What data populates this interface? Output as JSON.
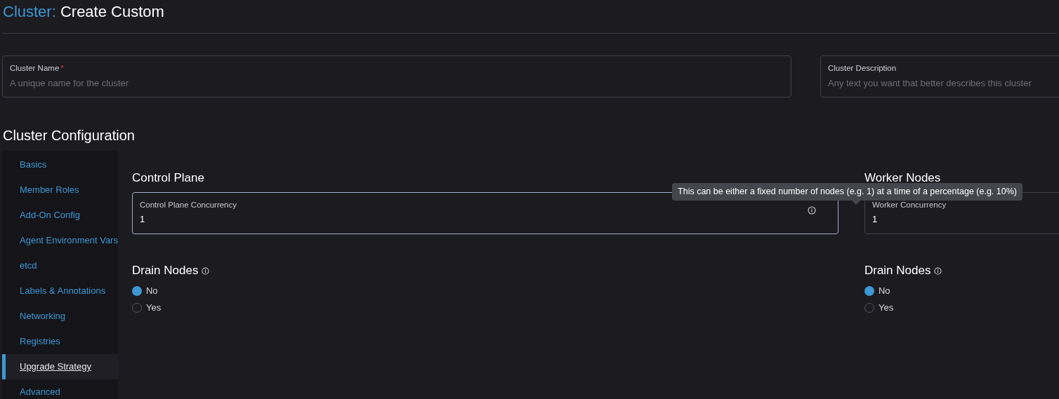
{
  "title": {
    "prefix": "Cluster:",
    "text": "Create Custom"
  },
  "fields": [
    {
      "label": "Cluster Name",
      "required_mark": "*",
      "placeholder": "A unique name for the cluster"
    },
    {
      "label": "Cluster Description",
      "placeholder": "Any text you want that better describes this cluster"
    }
  ],
  "section_title": "Cluster Configuration",
  "sidebar": {
    "items": [
      {
        "label": "Basics",
        "selected": false
      },
      {
        "label": "Member Roles",
        "selected": false
      },
      {
        "label": "Add-On Config",
        "selected": false
      },
      {
        "label": "Agent Environment Vars",
        "selected": false
      },
      {
        "label": "etcd",
        "selected": false
      },
      {
        "label": "Labels & Annotations",
        "selected": false
      },
      {
        "label": "Networking",
        "selected": false
      },
      {
        "label": "Registries",
        "selected": false
      },
      {
        "label": "Upgrade Strategy",
        "selected": true
      },
      {
        "label": "Advanced",
        "selected": false
      }
    ]
  },
  "columns": [
    {
      "heading": "Control Plane",
      "field": {
        "label": "Control Plane Concurrency",
        "value": "1",
        "info": true,
        "focused": true
      },
      "drain": {
        "heading": "Drain Nodes",
        "options": [
          {
            "label": "No",
            "selected": true
          },
          {
            "label": "Yes",
            "selected": false
          }
        ]
      }
    },
    {
      "heading": "Worker Nodes",
      "field": {
        "label": "Worker Concurrency",
        "value": "1",
        "info": false,
        "focused": false
      },
      "drain": {
        "heading": "Drain Nodes",
        "options": [
          {
            "label": "No",
            "selected": true
          },
          {
            "label": "Yes",
            "selected": false
          }
        ]
      }
    }
  ],
  "tooltip": {
    "text": "This can be either a fixed number of nodes (e.g. 1) at a time of a percentage (e.g. 10%)"
  }
}
